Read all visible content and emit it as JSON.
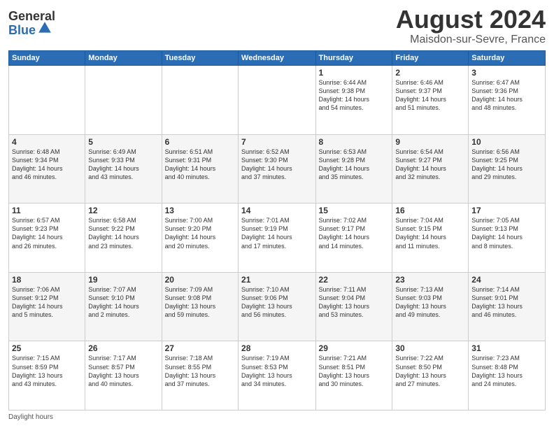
{
  "header": {
    "logo_general": "General",
    "logo_blue": "Blue",
    "month_title": "August 2024",
    "location": "Maisdon-sur-Sevre, France"
  },
  "footer": {
    "label": "Daylight hours"
  },
  "days_of_week": [
    "Sunday",
    "Monday",
    "Tuesday",
    "Wednesday",
    "Thursday",
    "Friday",
    "Saturday"
  ],
  "weeks": [
    {
      "days": [
        {
          "num": "",
          "info": ""
        },
        {
          "num": "",
          "info": ""
        },
        {
          "num": "",
          "info": ""
        },
        {
          "num": "",
          "info": ""
        },
        {
          "num": "1",
          "info": "Sunrise: 6:44 AM\nSunset: 9:38 PM\nDaylight: 14 hours\nand 54 minutes."
        },
        {
          "num": "2",
          "info": "Sunrise: 6:46 AM\nSunset: 9:37 PM\nDaylight: 14 hours\nand 51 minutes."
        },
        {
          "num": "3",
          "info": "Sunrise: 6:47 AM\nSunset: 9:36 PM\nDaylight: 14 hours\nand 48 minutes."
        }
      ]
    },
    {
      "days": [
        {
          "num": "4",
          "info": "Sunrise: 6:48 AM\nSunset: 9:34 PM\nDaylight: 14 hours\nand 46 minutes."
        },
        {
          "num": "5",
          "info": "Sunrise: 6:49 AM\nSunset: 9:33 PM\nDaylight: 14 hours\nand 43 minutes."
        },
        {
          "num": "6",
          "info": "Sunrise: 6:51 AM\nSunset: 9:31 PM\nDaylight: 14 hours\nand 40 minutes."
        },
        {
          "num": "7",
          "info": "Sunrise: 6:52 AM\nSunset: 9:30 PM\nDaylight: 14 hours\nand 37 minutes."
        },
        {
          "num": "8",
          "info": "Sunrise: 6:53 AM\nSunset: 9:28 PM\nDaylight: 14 hours\nand 35 minutes."
        },
        {
          "num": "9",
          "info": "Sunrise: 6:54 AM\nSunset: 9:27 PM\nDaylight: 14 hours\nand 32 minutes."
        },
        {
          "num": "10",
          "info": "Sunrise: 6:56 AM\nSunset: 9:25 PM\nDaylight: 14 hours\nand 29 minutes."
        }
      ]
    },
    {
      "days": [
        {
          "num": "11",
          "info": "Sunrise: 6:57 AM\nSunset: 9:23 PM\nDaylight: 14 hours\nand 26 minutes."
        },
        {
          "num": "12",
          "info": "Sunrise: 6:58 AM\nSunset: 9:22 PM\nDaylight: 14 hours\nand 23 minutes."
        },
        {
          "num": "13",
          "info": "Sunrise: 7:00 AM\nSunset: 9:20 PM\nDaylight: 14 hours\nand 20 minutes."
        },
        {
          "num": "14",
          "info": "Sunrise: 7:01 AM\nSunset: 9:19 PM\nDaylight: 14 hours\nand 17 minutes."
        },
        {
          "num": "15",
          "info": "Sunrise: 7:02 AM\nSunset: 9:17 PM\nDaylight: 14 hours\nand 14 minutes."
        },
        {
          "num": "16",
          "info": "Sunrise: 7:04 AM\nSunset: 9:15 PM\nDaylight: 14 hours\nand 11 minutes."
        },
        {
          "num": "17",
          "info": "Sunrise: 7:05 AM\nSunset: 9:13 PM\nDaylight: 14 hours\nand 8 minutes."
        }
      ]
    },
    {
      "days": [
        {
          "num": "18",
          "info": "Sunrise: 7:06 AM\nSunset: 9:12 PM\nDaylight: 14 hours\nand 5 minutes."
        },
        {
          "num": "19",
          "info": "Sunrise: 7:07 AM\nSunset: 9:10 PM\nDaylight: 14 hours\nand 2 minutes."
        },
        {
          "num": "20",
          "info": "Sunrise: 7:09 AM\nSunset: 9:08 PM\nDaylight: 13 hours\nand 59 minutes."
        },
        {
          "num": "21",
          "info": "Sunrise: 7:10 AM\nSunset: 9:06 PM\nDaylight: 13 hours\nand 56 minutes."
        },
        {
          "num": "22",
          "info": "Sunrise: 7:11 AM\nSunset: 9:04 PM\nDaylight: 13 hours\nand 53 minutes."
        },
        {
          "num": "23",
          "info": "Sunrise: 7:13 AM\nSunset: 9:03 PM\nDaylight: 13 hours\nand 49 minutes."
        },
        {
          "num": "24",
          "info": "Sunrise: 7:14 AM\nSunset: 9:01 PM\nDaylight: 13 hours\nand 46 minutes."
        }
      ]
    },
    {
      "days": [
        {
          "num": "25",
          "info": "Sunrise: 7:15 AM\nSunset: 8:59 PM\nDaylight: 13 hours\nand 43 minutes."
        },
        {
          "num": "26",
          "info": "Sunrise: 7:17 AM\nSunset: 8:57 PM\nDaylight: 13 hours\nand 40 minutes."
        },
        {
          "num": "27",
          "info": "Sunrise: 7:18 AM\nSunset: 8:55 PM\nDaylight: 13 hours\nand 37 minutes."
        },
        {
          "num": "28",
          "info": "Sunrise: 7:19 AM\nSunset: 8:53 PM\nDaylight: 13 hours\nand 34 minutes."
        },
        {
          "num": "29",
          "info": "Sunrise: 7:21 AM\nSunset: 8:51 PM\nDaylight: 13 hours\nand 30 minutes."
        },
        {
          "num": "30",
          "info": "Sunrise: 7:22 AM\nSunset: 8:50 PM\nDaylight: 13 hours\nand 27 minutes."
        },
        {
          "num": "31",
          "info": "Sunrise: 7:23 AM\nSunset: 8:48 PM\nDaylight: 13 hours\nand 24 minutes."
        }
      ]
    }
  ]
}
